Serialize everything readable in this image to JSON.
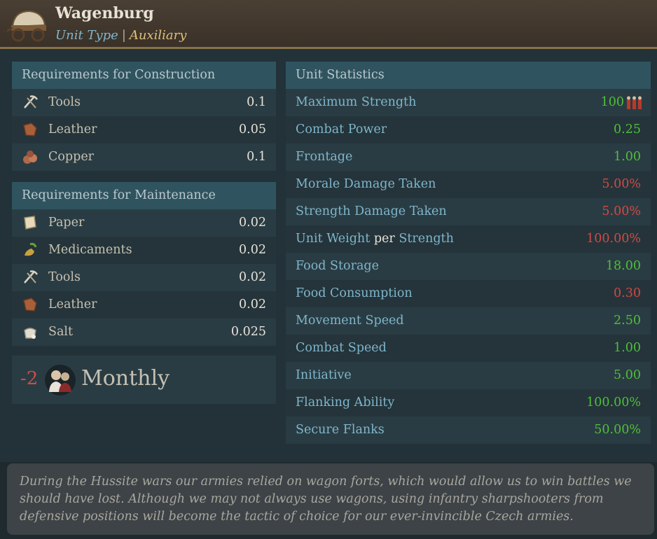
{
  "header": {
    "title": "Wagenburg",
    "unit_type_label": "Unit Type",
    "separator": "|",
    "unit_type_value": "Auxiliary",
    "icon": "wagon-icon"
  },
  "construction": {
    "heading": "Requirements for Construction",
    "items": [
      {
        "label": "Tools",
        "value": "0.1",
        "icon": "tools-icon"
      },
      {
        "label": "Leather",
        "value": "0.05",
        "icon": "leather-icon"
      },
      {
        "label": "Copper",
        "value": "0.1",
        "icon": "copper-icon"
      }
    ]
  },
  "maintenance": {
    "heading": "Requirements for Maintenance",
    "items": [
      {
        "label": "Paper",
        "value": "0.02",
        "icon": "paper-icon"
      },
      {
        "label": "Medicaments",
        "value": "0.02",
        "icon": "medicaments-icon"
      },
      {
        "label": "Tools",
        "value": "0.02",
        "icon": "tools-icon"
      },
      {
        "label": "Leather",
        "value": "0.02",
        "icon": "leather-icon"
      },
      {
        "label": "Salt",
        "value": "0.025",
        "icon": "salt-icon"
      }
    ]
  },
  "upkeep": {
    "value": "-2",
    "label": "Monthly",
    "icon": "population-icon"
  },
  "stats": {
    "heading": "Unit Statistics",
    "rows": [
      {
        "label": "Maximum Strength",
        "value": "100",
        "tone": "green"
      },
      {
        "label": "Combat Power",
        "value": "0.25",
        "tone": "green"
      },
      {
        "label": "Frontage",
        "value": "1.00",
        "tone": "green"
      },
      {
        "label": "Morale Damage Taken",
        "value": "5.00%",
        "tone": "red"
      },
      {
        "label": "Strength Damage Taken",
        "value": "5.00%",
        "tone": "red"
      },
      {
        "label": "Unit Weight",
        "label_mid": "per",
        "label_end": "Strength",
        "value": "100.00%",
        "tone": "red"
      },
      {
        "label": "Food Storage",
        "value": "18.00",
        "tone": "green"
      },
      {
        "label": "Food Consumption",
        "value": "0.30",
        "tone": "red"
      },
      {
        "label": "Movement Speed",
        "value": "2.50",
        "tone": "green"
      },
      {
        "label": "Combat Speed",
        "value": "1.00",
        "tone": "green"
      },
      {
        "label": "Initiative",
        "value": "5.00",
        "tone": "green"
      },
      {
        "label": "Flanking Ability",
        "value": "100.00%",
        "tone": "green"
      },
      {
        "label": "Secure Flanks",
        "value": "50.00%",
        "tone": "green"
      }
    ]
  },
  "description": "During the Hussite wars our armies relied on wagon forts, which would allow us to win battles we should have lost. Although we may not always use wagons, using infantry sharpshooters from defensive positions will become the tactic of choice for our ever-invincible Czech armies.",
  "colors": {
    "positive": "#4fbf3a",
    "negative": "#d14a45",
    "stat_label": "#7fb6cc",
    "subtype": "#e0c07a"
  }
}
